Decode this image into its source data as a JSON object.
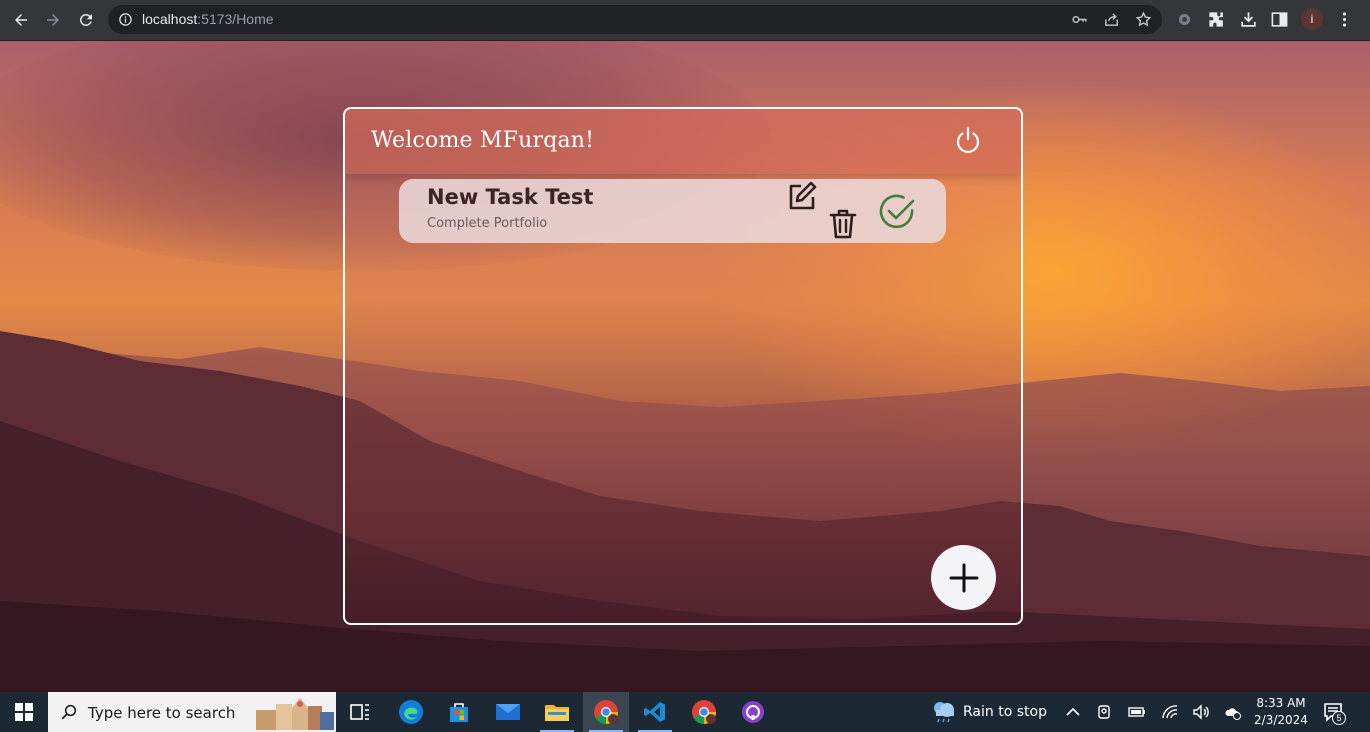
{
  "browser": {
    "url_host": "localhost",
    "url_rest": ":5173/Home"
  },
  "profile": {
    "initial": "i"
  },
  "app": {
    "title": "Welcome MFurqan!",
    "tasks": [
      {
        "title": "New Task Test",
        "description": "Complete Portfolio"
      }
    ]
  },
  "taskbar": {
    "search_placeholder": "Type here to search",
    "weather": "Rain to stop",
    "time": "8:33 AM",
    "date": "2/3/2024",
    "notification_count": "5"
  },
  "colors": {
    "check_green": "#3f7d3c",
    "icon_dark": "#2c1e1e",
    "card_border": "#ffffff"
  }
}
